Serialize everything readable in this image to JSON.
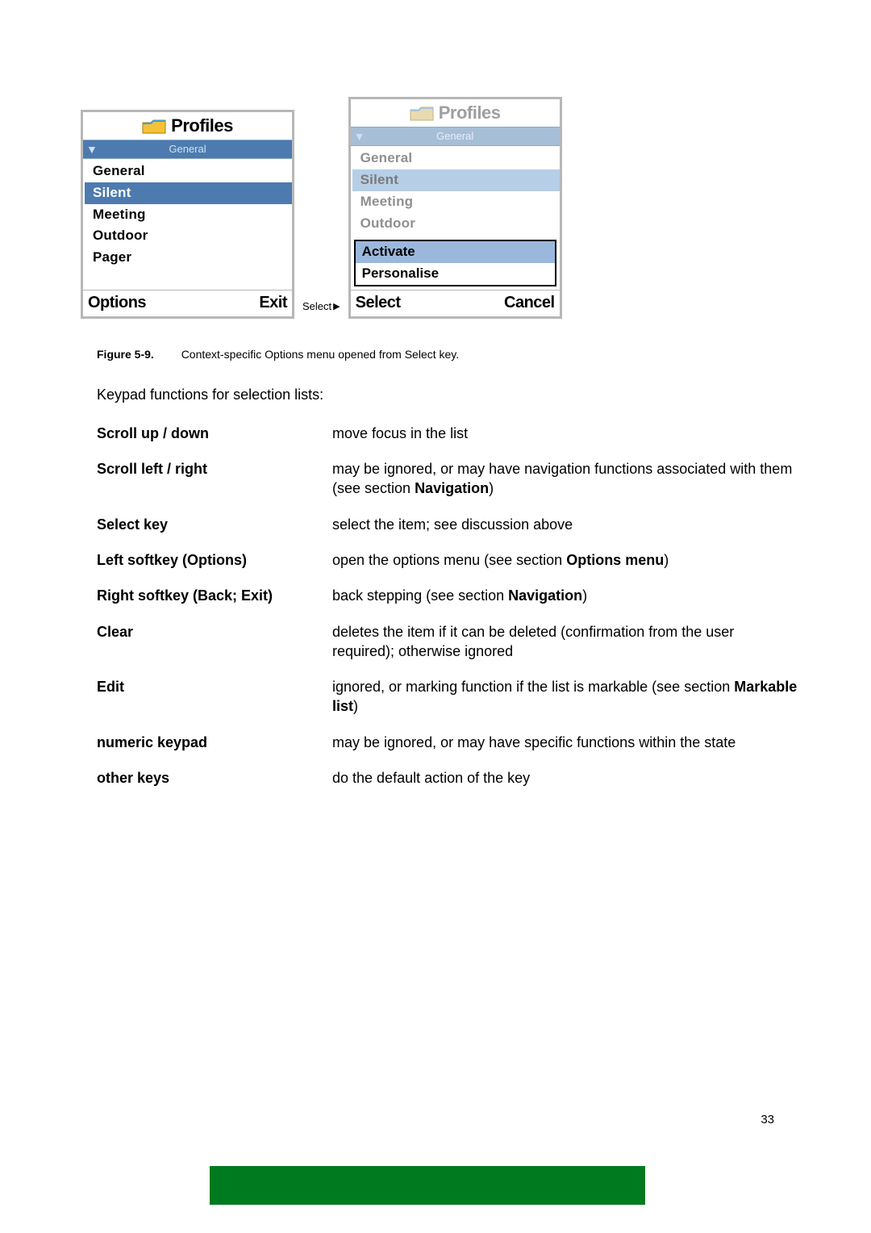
{
  "figure": {
    "left_screen": {
      "title": "Profiles",
      "status_label": "General",
      "items": [
        "General",
        "Silent",
        "Meeting",
        "Outdoor",
        "Pager"
      ],
      "selected_index": 1,
      "soft_left": "Options",
      "soft_right": "Exit"
    },
    "between_label": "Select",
    "right_screen": {
      "title": "Profiles",
      "status_label": "General",
      "items": [
        "General",
        "Silent",
        "Meeting",
        "Outdoor"
      ],
      "selected_index": 1,
      "popup": {
        "items": [
          "Activate",
          "Personalise"
        ],
        "selected_index": 0
      },
      "soft_left": "Select",
      "soft_right": "Cancel"
    }
  },
  "caption": {
    "number": "Figure 5-9.",
    "text": "Context-specific Options menu opened from Select key."
  },
  "intro": "Keypad functions for selection lists:",
  "defs": [
    {
      "term": "Scroll up / down",
      "desc": "move focus in the list"
    },
    {
      "term": "Scroll left / right",
      "desc": "may be ignored, or may have navigation functions associated with them (see section ",
      "bold": "Navigation",
      "tail": ")"
    },
    {
      "term": "Select key",
      "desc": "select the item; see discussion above"
    },
    {
      "term": "Left softkey (Options)",
      "desc": "open the options menu (see section ",
      "bold": "Options menu",
      "tail": ")"
    },
    {
      "term": "Right softkey (Back; Exit)",
      "desc": "back stepping (see section ",
      "bold": "Navigation",
      "tail": ")"
    },
    {
      "term": "Clear",
      "desc": "deletes the item if it can be deleted (confirmation from the user required); otherwise ignored"
    },
    {
      "term": "Edit",
      "desc": "ignored, or marking function if the list is markable (see section ",
      "bold": "Markable list",
      "tail": ")"
    },
    {
      "term": "numeric keypad",
      "desc": "may be ignored, or may have specific functions within the state"
    },
    {
      "term": "other keys",
      "desc": "do the default action of the key"
    }
  ],
  "page_number": "33"
}
